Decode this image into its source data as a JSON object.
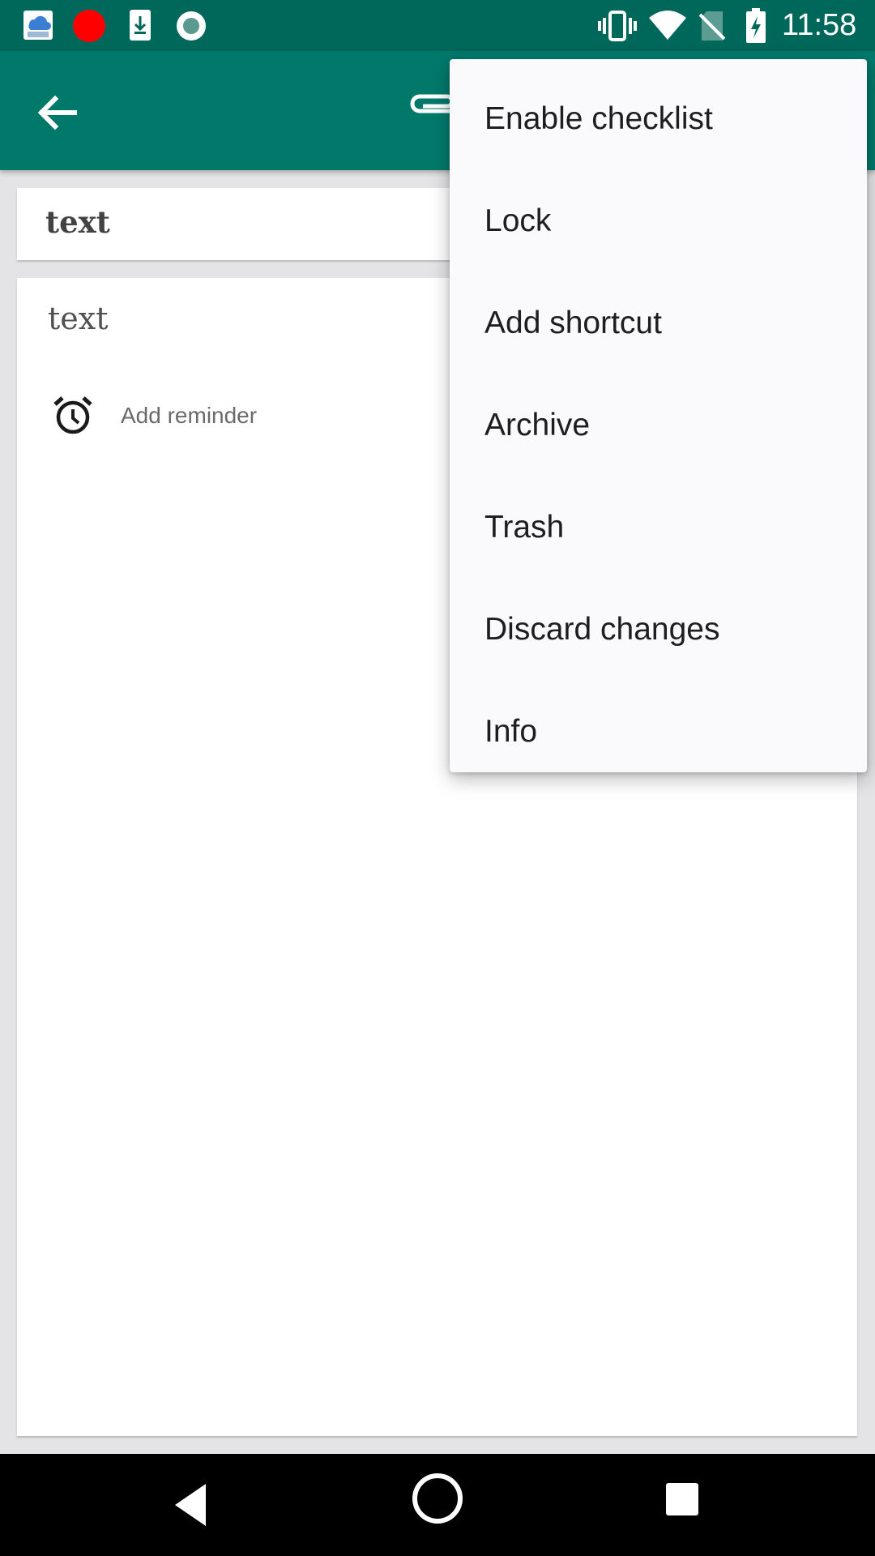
{
  "status_bar": {
    "time": "11:58",
    "left_icons": [
      "weather-app-icon",
      "record-dot-icon",
      "download-icon",
      "circle-app-icon"
    ],
    "right_icons": [
      "vibrate-icon",
      "wifi-icon",
      "no-sim-icon",
      "battery-charging-icon"
    ]
  },
  "app_bar": {
    "back_icon": "arrow-back-icon",
    "attach_icon": "paperclip-icon",
    "color": "#00796b"
  },
  "note": {
    "title": "text",
    "content": "text",
    "reminder_label": "Add reminder"
  },
  "menu": {
    "items": [
      {
        "label": "Enable checklist"
      },
      {
        "label": "Lock"
      },
      {
        "label": "Add shortcut"
      },
      {
        "label": "Archive"
      },
      {
        "label": "Trash"
      },
      {
        "label": "Discard changes"
      },
      {
        "label": "Info"
      }
    ]
  },
  "nav_bar": {
    "icons": [
      "nav-back-icon",
      "nav-home-icon",
      "nav-recents-icon"
    ]
  }
}
